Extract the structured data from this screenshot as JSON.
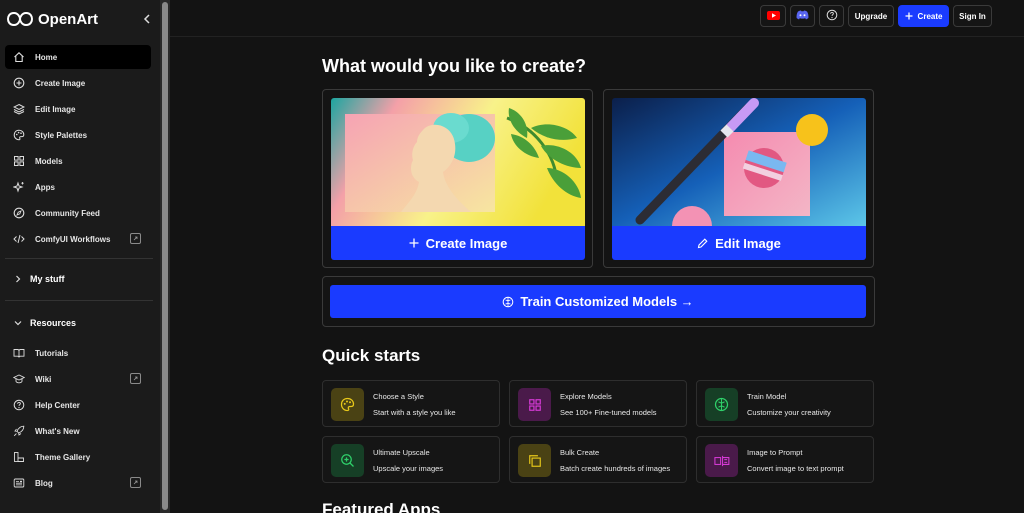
{
  "app": {
    "name": "OpenArt"
  },
  "colors": {
    "accent": "#1a3bff",
    "sidebar_bg": "#1b1b1b",
    "page_bg": "#131313",
    "youtube_red": "#ff0000",
    "discord_blue": "#5865f2"
  },
  "sidebar": {
    "collapse_icon": "chevron-left-icon",
    "nav": [
      {
        "label": "Home",
        "icon": "home-icon",
        "active": true
      },
      {
        "label": "Create Image",
        "icon": "plus-circle-icon"
      },
      {
        "label": "Edit Image",
        "icon": "layers-icon"
      },
      {
        "label": "Style Palettes",
        "icon": "palette-icon"
      },
      {
        "label": "Models",
        "icon": "grid-icon"
      },
      {
        "label": "Apps",
        "icon": "sparkles-icon"
      },
      {
        "label": "Community Feed",
        "icon": "compass-icon"
      },
      {
        "label": "ComfyUI Workflows",
        "icon": "code-icon",
        "external": true
      }
    ],
    "my_stuff": "My stuff",
    "resources": "Resources",
    "resource_items": [
      {
        "label": "Tutorials",
        "icon": "book-icon"
      },
      {
        "label": "Wiki",
        "icon": "graduation-cap-icon",
        "external": true
      },
      {
        "label": "Help Center",
        "icon": "help-circle-icon"
      },
      {
        "label": "What's New",
        "icon": "rocket-icon"
      },
      {
        "label": "Theme Gallery",
        "icon": "theme-icon"
      },
      {
        "label": "Blog",
        "icon": "newspaper-icon",
        "external": true
      }
    ]
  },
  "topbar": {
    "upgrade": "Upgrade",
    "create": "Create",
    "sign_in": "Sign In"
  },
  "main": {
    "heading": "What would you like to create?",
    "create_card": {
      "button": "Create Image"
    },
    "edit_card": {
      "button": "Edit Image"
    },
    "train_button": "Train Customized Models →",
    "quick_starts_heading": "Quick starts",
    "quick_starts": [
      {
        "title": "Choose a Style",
        "subtitle": "Start with a style you like",
        "icon": "palette-icon",
        "color": "#e8c81a"
      },
      {
        "title": "Explore Models",
        "subtitle": "See 100+ Fine-tuned models",
        "icon": "grid-icon",
        "color": "#d83bd8"
      },
      {
        "title": "Train Model",
        "subtitle": "Customize your creativity",
        "icon": "brain-icon",
        "color": "#2fd06a"
      },
      {
        "title": "Ultimate Upscale",
        "subtitle": "Upscale your images",
        "icon": "zoom-in-icon",
        "color": "#2fd06a"
      },
      {
        "title": "Bulk Create",
        "subtitle": "Batch create hundreds of images",
        "icon": "copy-icon",
        "color": "#e8c81a"
      },
      {
        "title": "Image to Prompt",
        "subtitle": "Convert image to text prompt",
        "icon": "image-to-text-icon",
        "color": "#d83bd8"
      }
    ],
    "featured_heading": "Featured Apps"
  }
}
